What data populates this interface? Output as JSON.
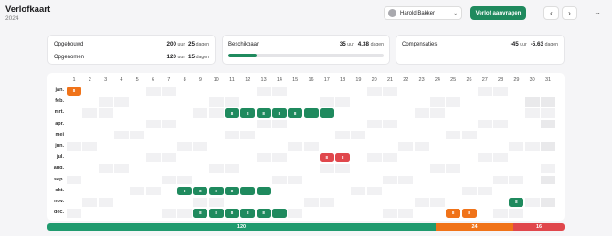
{
  "header": {
    "title": "Verlofkaart",
    "year": "2024"
  },
  "toolbar": {
    "user_name": "Harold Bakker",
    "user_chevron": "⌄",
    "request_label": "Verlof aanvragen",
    "prev_glyph": "‹",
    "next_glyph": "›",
    "more_glyph": "···"
  },
  "summary": {
    "opgebouwd": {
      "label": "Opgebouwd",
      "hours": "200",
      "hours_unit": "uur",
      "days": "25",
      "days_unit": "dagen"
    },
    "opgenomen": {
      "label": "Opgenomen",
      "hours": "120",
      "hours_unit": "uur",
      "days": "15",
      "days_unit": "dagen"
    },
    "beschikbaar": {
      "label": "Beschikbaar",
      "hours": "35",
      "hours_unit": "uur",
      "days": "4,38",
      "days_unit": "dagen",
      "progress_fraction": 0.18
    },
    "compensaties": {
      "label": "Compensaties",
      "hours": "-45",
      "hours_unit": "uur",
      "days": "-5,63",
      "days_unit": "dagen"
    }
  },
  "calendar": {
    "days": [
      "1",
      "2",
      "3",
      "4",
      "5",
      "6",
      "7",
      "8",
      "9",
      "10",
      "11",
      "12",
      "13",
      "14",
      "15",
      "16",
      "17",
      "18",
      "19",
      "20",
      "21",
      "22",
      "23",
      "24",
      "25",
      "26",
      "27",
      "28",
      "29",
      "30",
      "31"
    ],
    "months": [
      "jan.",
      "feb.",
      "mrt.",
      "apr.",
      "mei",
      "jun.",
      "jul.",
      "aug.",
      "sep.",
      "okt.",
      "nov.",
      "dec."
    ],
    "year": 2024,
    "entries": [
      {
        "month": 0,
        "day": 1,
        "type": "orange",
        "text": "8"
      },
      {
        "month": 2,
        "day": 11,
        "type": "green",
        "text": "8"
      },
      {
        "month": 2,
        "day": 12,
        "type": "green",
        "text": "8"
      },
      {
        "month": 2,
        "day": 13,
        "type": "green",
        "text": "8"
      },
      {
        "month": 2,
        "day": 14,
        "type": "green",
        "text": "8"
      },
      {
        "month": 2,
        "day": 15,
        "type": "green",
        "text": "8"
      },
      {
        "month": 2,
        "day": 16,
        "type": "green",
        "text": ""
      },
      {
        "month": 2,
        "day": 17,
        "type": "green",
        "text": ""
      },
      {
        "month": 6,
        "day": 17,
        "type": "red",
        "text": "8"
      },
      {
        "month": 6,
        "day": 18,
        "type": "red",
        "text": "8"
      },
      {
        "month": 9,
        "day": 8,
        "type": "green",
        "text": "8"
      },
      {
        "month": 9,
        "day": 9,
        "type": "green",
        "text": "8"
      },
      {
        "month": 9,
        "day": 10,
        "type": "green",
        "text": "8"
      },
      {
        "month": 9,
        "day": 11,
        "type": "green",
        "text": "8"
      },
      {
        "month": 9,
        "day": 12,
        "type": "green",
        "text": ""
      },
      {
        "month": 9,
        "day": 13,
        "type": "green",
        "text": ""
      },
      {
        "month": 10,
        "day": 29,
        "type": "green",
        "text": "8"
      },
      {
        "month": 11,
        "day": 9,
        "type": "green",
        "text": "8"
      },
      {
        "month": 11,
        "day": 10,
        "type": "green",
        "text": "8"
      },
      {
        "month": 11,
        "day": 11,
        "type": "green",
        "text": "8"
      },
      {
        "month": 11,
        "day": 12,
        "type": "green",
        "text": "8"
      },
      {
        "month": 11,
        "day": 13,
        "type": "green",
        "text": "8"
      },
      {
        "month": 11,
        "day": 14,
        "type": "green",
        "text": ""
      },
      {
        "month": 11,
        "day": 25,
        "type": "orange",
        "text": "8"
      },
      {
        "month": 11,
        "day": 26,
        "type": "orange",
        "text": "8"
      }
    ]
  },
  "totals": [
    {
      "type": "green",
      "value": "120",
      "hours": 120
    },
    {
      "type": "orange",
      "value": "24",
      "hours": 24
    },
    {
      "type": "red",
      "value": "16",
      "hours": 16
    }
  ],
  "colors": {
    "green": "#1f8a5e",
    "orange": "#f07319",
    "red": "#e0474c",
    "weekend": "#f1f1f3"
  }
}
